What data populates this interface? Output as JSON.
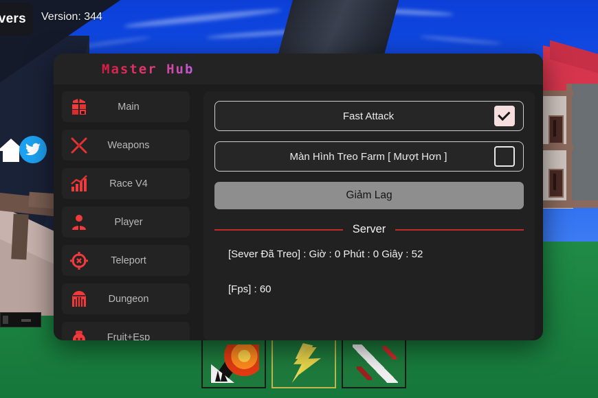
{
  "hud": {
    "servers_button": "vers",
    "version_label": "Version: 344",
    "home_icon": "home-icon",
    "twitter_icon": "twitter-icon"
  },
  "panel": {
    "title": "Master Hub",
    "title_gradient_from": "#d81b45",
    "title_gradient_to": "#c05ad8"
  },
  "sidebar": {
    "items": [
      {
        "label": "Main",
        "icon": "gift-box-icon"
      },
      {
        "label": "Weapons",
        "icon": "crossed-swords-icon"
      },
      {
        "label": "Race V4",
        "icon": "bar-chart-up-icon"
      },
      {
        "label": "Player",
        "icon": "person-icon"
      },
      {
        "label": "Teleport",
        "icon": "crosshair-target-icon"
      },
      {
        "label": "Dungeon",
        "icon": "dungeon-gate-icon"
      },
      {
        "label": "Fruit+Esp",
        "icon": "fruit-icon"
      }
    ]
  },
  "content": {
    "toggles": [
      {
        "label": "Fast Attack",
        "checked": true
      },
      {
        "label": "Màn Hình Treo Farm [ Mượt Hơn ]",
        "checked": false
      }
    ],
    "button": "Giảm Lag",
    "section_title": "Server",
    "stats": [
      "[Sever Đã Treo] : Giờ : 0  Phút : 0  Giây : 52",
      "[Fps] : 60"
    ]
  },
  "inventory": {
    "slots": [
      {
        "name": "flame-weapon-item"
      },
      {
        "name": "lightning-fruit-item"
      },
      {
        "name": "spear-weapon-item"
      }
    ]
  },
  "colors": {
    "accent_red": "#c22b2b",
    "panel_bg": "#1c1c1c",
    "button_gray": "#8e8e8e"
  }
}
